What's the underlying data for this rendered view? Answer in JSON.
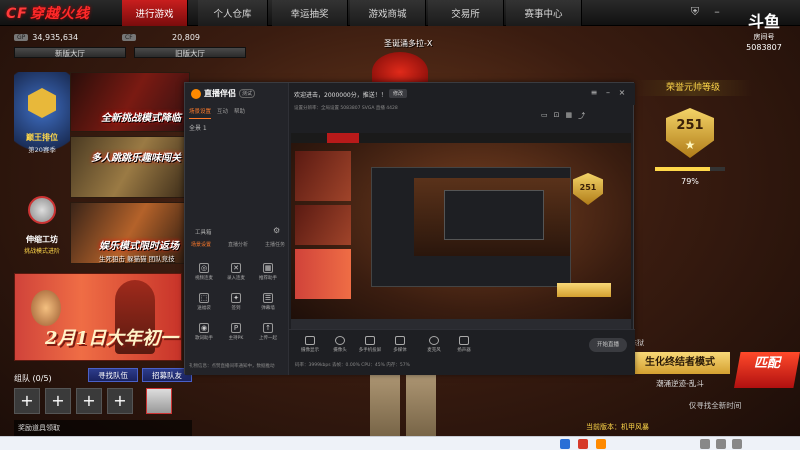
{
  "nav": {
    "logo_prefix": "CF",
    "logo": "穿越火线",
    "tabs": [
      "进行游戏",
      "个人仓库",
      "幸运抽奖",
      "游戏商城",
      "交易所",
      "赛事中心"
    ]
  },
  "currency": {
    "gp_tag": "GP",
    "gp": "34,935,634",
    "cf_tag": "CF",
    "cf": "20,809"
  },
  "halls": {
    "new": "新版大厅",
    "old": "旧版大厅"
  },
  "left": {
    "rank_title": "巅王排位",
    "rank_sub": "第20赛季",
    "prog_title": "伸缩工坊",
    "prog_sub": "挑战模式进阶",
    "banner1": "全新挑战模式降临",
    "banner2": "多人跳跳乐趣味闯关",
    "banner3_title": "娱乐模式限时返场",
    "banner3_sub": "生死狙击 躲猫猫 团队竞技",
    "banner4": "2月1日大年初一"
  },
  "team": {
    "label": "组队 (0/5)",
    "find": "寻找队伍",
    "recruit": "招募队友",
    "slot_plus": "+",
    "chat": "奖励道具领取"
  },
  "character": {
    "name": "圣诞涌多拉-X"
  },
  "douyu": {
    "logo": "斗鱼",
    "sub": "房间号",
    "room": "5083807"
  },
  "rank_panel": {
    "title": "荣誉元帅等级",
    "level": "251",
    "progress_pct": 79,
    "progress_label": "79%"
  },
  "mode": {
    "tag": "炼狱",
    "name": "生化终结者模式",
    "match": "匹配",
    "sub": "潮涌逆迹-乱斗",
    "sub2": "仅寻找全新时间",
    "version": "当前版本：机甲风暴"
  },
  "app": {
    "name": "直播伴侣",
    "badge": "测试",
    "tabs": [
      "场景设置",
      "互动",
      "帮助"
    ],
    "scene": "全景 1",
    "tools_label": "工具箱",
    "tool_tabs": [
      "场景设置",
      "直播分析",
      "主播任务"
    ],
    "tools": [
      {
        "icon": "◎",
        "label": "视频连麦"
      },
      {
        "icon": "✕",
        "label": "录入连麦"
      },
      {
        "icon": "▦",
        "label": "推荐助手"
      },
      {
        "icon": "⬚",
        "label": "送福袋"
      },
      {
        "icon": "✦",
        "label": "签到"
      },
      {
        "icon": "☰",
        "label": "弹幕墙"
      },
      {
        "icon": "◉",
        "label": "歌词助手"
      },
      {
        "icon": "P",
        "label": "主持PK"
      },
      {
        "icon": "↑",
        "label": "上传一起"
      }
    ],
    "foot_note": "礼物信息：点赞直播间率通知中，数据推动",
    "title": "欢迎进击，2000000分，推送！！",
    "edit": "修改",
    "subline": "设置分辨率：全局设置  5083807  SVGA  直播  4428",
    "bottom": [
      {
        "label": "摄像显示"
      },
      {
        "label": "摄像头"
      },
      {
        "label": "多手机投屏"
      },
      {
        "label": "多媒体"
      },
      {
        "label": "麦克风"
      },
      {
        "label": "扬声器"
      }
    ],
    "live": "开始直播",
    "stats": "码率：3999kbps  丢帧：0.00%  CPU：45%  内存：57%"
  }
}
